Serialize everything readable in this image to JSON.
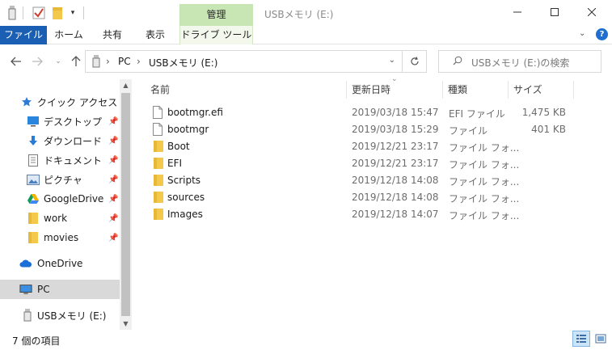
{
  "titlebar": {
    "context_tab": "管理",
    "title": "USBメモリ (E:)"
  },
  "ribbon": {
    "tabs": [
      {
        "label": "ファイル"
      },
      {
        "label": "ホーム"
      },
      {
        "label": "共有"
      },
      {
        "label": "表示"
      },
      {
        "label": "ドライブ ツール"
      }
    ]
  },
  "address": {
    "segments": [
      "PC",
      "USBメモリ (E:)"
    ]
  },
  "search": {
    "placeholder": "USBメモリ (E:)の検索"
  },
  "sidebar": {
    "items": [
      {
        "label": "クイック アクセス",
        "icon": "star-icon",
        "pinned": false
      },
      {
        "label": "デスクトップ",
        "icon": "desktop-icon",
        "pinned": true
      },
      {
        "label": "ダウンロード",
        "icon": "download-icon",
        "pinned": true
      },
      {
        "label": "ドキュメント",
        "icon": "document-icon",
        "pinned": true
      },
      {
        "label": "ピクチャ",
        "icon": "pictures-icon",
        "pinned": true
      },
      {
        "label": "GoogleDrive",
        "icon": "google-drive-icon",
        "pinned": true
      },
      {
        "label": "work",
        "icon": "folder-icon",
        "pinned": true
      },
      {
        "label": "movies",
        "icon": "folder-icon",
        "pinned": true
      },
      {
        "label": "OneDrive",
        "icon": "cloud-icon",
        "pinned": false
      },
      {
        "label": "PC",
        "icon": "pc-icon",
        "pinned": false,
        "selected": true
      },
      {
        "label": "USBメモリ (E:)",
        "icon": "usb-drive-icon",
        "pinned": false
      }
    ]
  },
  "columns": {
    "name": "名前",
    "date": "更新日時",
    "type": "種類",
    "size": "サイズ"
  },
  "files": [
    {
      "name": "bootmgr.efi",
      "date": "2019/03/18 15:47",
      "type": "EFI ファイル",
      "size": "1,475 KB",
      "icon": "file-icon"
    },
    {
      "name": "bootmgr",
      "date": "2019/03/18 15:29",
      "type": "ファイル",
      "size": "401 KB",
      "icon": "file-icon"
    },
    {
      "name": "Boot",
      "date": "2019/12/21 23:17",
      "type": "ファイル フォ...",
      "size": "",
      "icon": "folder-icon"
    },
    {
      "name": "EFI",
      "date": "2019/12/21 23:17",
      "type": "ファイル フォ...",
      "size": "",
      "icon": "folder-icon"
    },
    {
      "name": "Scripts",
      "date": "2019/12/18 14:08",
      "type": "ファイル フォ...",
      "size": "",
      "icon": "folder-icon"
    },
    {
      "name": "sources",
      "date": "2019/12/18 14:08",
      "type": "ファイル フォ...",
      "size": "",
      "icon": "folder-icon"
    },
    {
      "name": "Images",
      "date": "2019/12/18 14:07",
      "type": "ファイル フォ...",
      "size": "",
      "icon": "folder-icon"
    }
  ],
  "status": {
    "count": "7 個の項目"
  },
  "colors": {
    "file_tab": "#1a5fb4",
    "context_tab": "#c8e6b3",
    "folder": "#f3c84b",
    "selection": "#d9d9d9"
  }
}
